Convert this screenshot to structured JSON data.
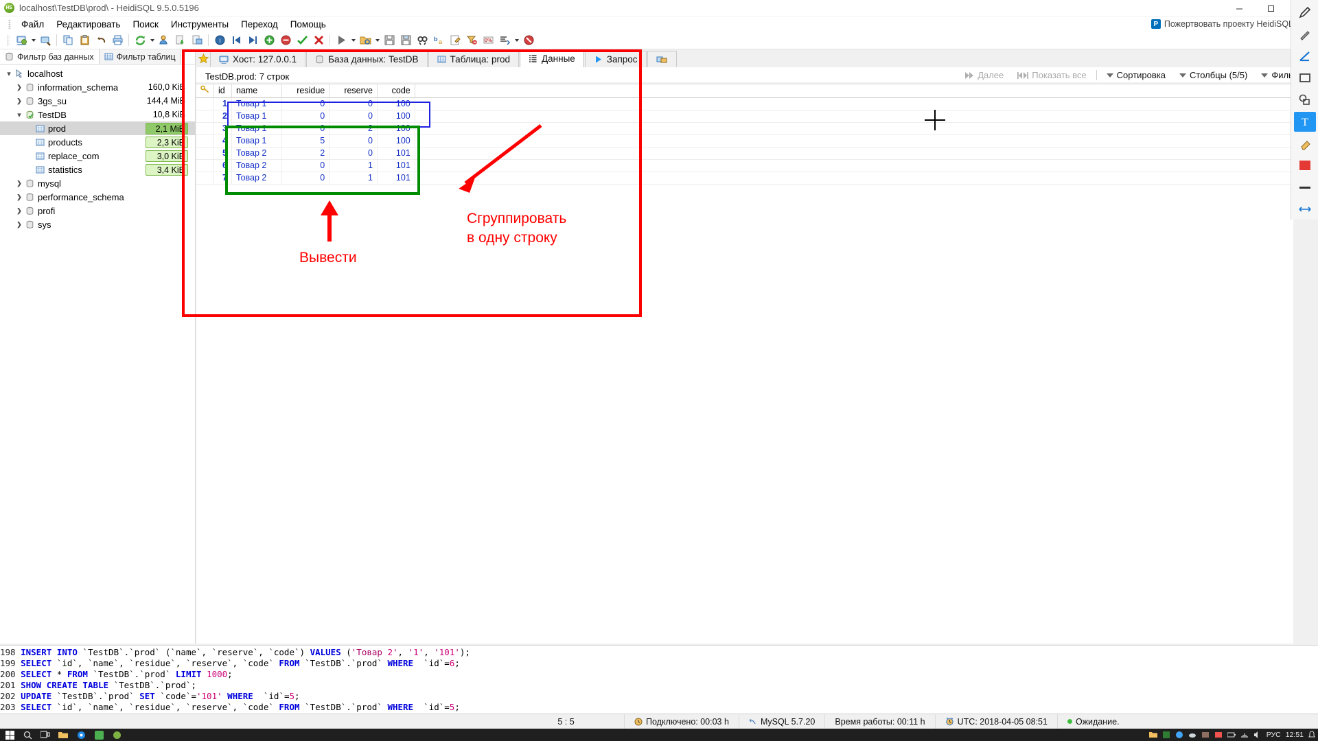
{
  "window": {
    "title": "localhost\\TestDB\\prod\\ - HeidiSQL 9.5.0.5196",
    "logo_text": "HS",
    "minimize_label": "–",
    "maximize_label": "□",
    "close_label": "✕"
  },
  "menu": {
    "items": [
      "Файл",
      "Редактировать",
      "Поиск",
      "Инструменты",
      "Переход",
      "Помощь"
    ]
  },
  "donate": {
    "label": "Пожертвовать проекту HeidiSQL",
    "icon": "paypal-icon",
    "badge": "P"
  },
  "toolbar": {
    "buttons": [
      {
        "name": "session-manager-icon",
        "tip": "Менеджер сессий"
      },
      {
        "name": "new-query-icon",
        "tip": "Новый запрос"
      },
      {
        "name": "copy-icon",
        "tip": "Копировать"
      },
      {
        "name": "paste-icon",
        "tip": "Вставить"
      },
      {
        "name": "undo-icon",
        "tip": "Отменить"
      },
      {
        "name": "print-icon",
        "tip": "Печать"
      },
      {
        "name": "refresh-icon",
        "tip": "Обновить"
      },
      {
        "name": "users-icon",
        "tip": "Менеджер пользователей"
      },
      {
        "name": "export-grid-icon",
        "tip": "Экспорт данных"
      },
      {
        "name": "import-icon",
        "tip": "Импорт"
      },
      {
        "name": "info-icon",
        "tip": "Информация"
      },
      {
        "name": "first-record-icon",
        "tip": "Первая запись"
      },
      {
        "name": "last-record-icon",
        "tip": "Последняя запись"
      },
      {
        "name": "insert-row-icon",
        "tip": "Вставить строку"
      },
      {
        "name": "delete-row-icon",
        "tip": "Удалить строку"
      },
      {
        "name": "apply-icon",
        "tip": "Применить"
      },
      {
        "name": "cancel-icon",
        "tip": "Отменить изменения"
      },
      {
        "name": "run-query-icon",
        "tip": "Выполнить"
      },
      {
        "name": "open-file-icon",
        "tip": "Открыть файл"
      },
      {
        "name": "save-icon",
        "tip": "Сохранить"
      },
      {
        "name": "save-as-icon",
        "tip": "Сохранить как"
      },
      {
        "name": "find-icon",
        "tip": "Найти"
      },
      {
        "name": "replace-icon",
        "tip": "Заменить"
      },
      {
        "name": "edit-icon",
        "tip": "Редактировать"
      },
      {
        "name": "stop-icon",
        "tip": "Остановить"
      }
    ]
  },
  "sidebar": {
    "filter_tabs": [
      {
        "label": "Фильтр баз данных",
        "icon": "database-icon",
        "active": false
      },
      {
        "label": "Фильтр таблиц",
        "icon": "table-icon",
        "active": true
      }
    ],
    "tree": [
      {
        "label": "localhost",
        "size": "",
        "indent": 0,
        "chev": "open",
        "icon": "host-icon",
        "selected": false,
        "chip": false
      },
      {
        "label": "information_schema",
        "size": "160,0 KiB",
        "indent": 1,
        "chev": "closed",
        "icon": "database-icon",
        "selected": false,
        "chip": false
      },
      {
        "label": "3gs_su",
        "size": "144,4 MiB",
        "indent": 1,
        "chev": "closed",
        "icon": "database-icon",
        "selected": false,
        "chip": false
      },
      {
        "label": "TestDB",
        "size": "10,8 KiB",
        "indent": 1,
        "chev": "open",
        "icon": "database-active-icon",
        "selected": false,
        "chip": false
      },
      {
        "label": "prod",
        "size": "2,1 MiB",
        "indent": 2,
        "chev": "none",
        "icon": "table-icon",
        "selected": true,
        "chip": true
      },
      {
        "label": "products",
        "size": "2,3 KiB",
        "indent": 2,
        "chev": "none",
        "icon": "table-icon",
        "selected": false,
        "chip": true
      },
      {
        "label": "replace_com",
        "size": "3,0 KiB",
        "indent": 2,
        "chev": "none",
        "icon": "table-icon",
        "selected": false,
        "chip": true
      },
      {
        "label": "statistics",
        "size": "3,4 KiB",
        "indent": 2,
        "chev": "none",
        "icon": "table-icon",
        "selected": false,
        "chip": true
      },
      {
        "label": "mysql",
        "size": "",
        "indent": 1,
        "chev": "closed",
        "icon": "database-icon",
        "selected": false,
        "chip": false
      },
      {
        "label": "performance_schema",
        "size": "",
        "indent": 1,
        "chev": "closed",
        "icon": "database-icon",
        "selected": false,
        "chip": false
      },
      {
        "label": "profi",
        "size": "",
        "indent": 1,
        "chev": "closed",
        "icon": "database-icon",
        "selected": false,
        "chip": false
      },
      {
        "label": "sys",
        "size": "",
        "indent": 1,
        "chev": "closed",
        "icon": "database-icon",
        "selected": false,
        "chip": false
      }
    ]
  },
  "tabs": [
    {
      "label": "Хост: 127.0.0.1",
      "icon": "host-icon",
      "active": false
    },
    {
      "label": "База данных: TestDB",
      "icon": "database-icon",
      "active": false
    },
    {
      "label": "Таблица: prod",
      "icon": "table-icon",
      "active": false
    },
    {
      "label": "Данные",
      "icon": "data-icon",
      "active": true
    },
    {
      "label": "Запрос",
      "icon": "play-icon",
      "active": false
    },
    {
      "label": "",
      "icon": "new-tab-icon",
      "active": false
    }
  ],
  "grid": {
    "caption": "TestDB.prod: 7 строк",
    "tools": [
      {
        "label": "Далее",
        "icon": "next-icon",
        "disabled": true
      },
      {
        "label": "Показать все",
        "icon": "show-all-icon",
        "disabled": true
      },
      {
        "label": "Сортировка",
        "icon": "caret-down-icon",
        "disabled": false
      },
      {
        "label": "Столбцы (5/5)",
        "icon": "caret-down-icon",
        "disabled": false
      },
      {
        "label": "Фильтр",
        "icon": "caret-down-icon",
        "disabled": false
      }
    ],
    "columns": [
      "id",
      "name",
      "residue",
      "reserve",
      "code"
    ],
    "key_icon": "primary-key-icon",
    "rows": [
      {
        "id": "1",
        "name": "Товар 1",
        "residue": "0",
        "reserve": "0",
        "code": "100"
      },
      {
        "id": "2",
        "name": "Товар 1",
        "residue": "0",
        "reserve": "0",
        "code": "100"
      },
      {
        "id": "3",
        "name": "Товар 1",
        "residue": "0",
        "reserve": "2",
        "code": "100"
      },
      {
        "id": "4",
        "name": "Товар 1",
        "residue": "5",
        "reserve": "0",
        "code": "100"
      },
      {
        "id": "5",
        "name": "Товар 2",
        "residue": "2",
        "reserve": "0",
        "code": "101"
      },
      {
        "id": "6",
        "name": "Товар 2",
        "residue": "0",
        "reserve": "1",
        "code": "101"
      },
      {
        "id": "7",
        "name": "Товар 2",
        "residue": "0",
        "reserve": "1",
        "code": "101"
      }
    ]
  },
  "annotations": {
    "group_text_line1": "Сгруппировать",
    "group_text_line2": "в одну строку",
    "output_text": "Вывести",
    "red_color": "#fb0000",
    "blue_color": "#2020e0",
    "green_color": "#008c00"
  },
  "sql_log": {
    "lines": [
      {
        "num": "198",
        "sql": "INSERT INTO `TestDB`.`prod` (`name`, `reserve`, `code`) VALUES ('Товар 2', '1', '101');"
      },
      {
        "num": "199",
        "sql": "SELECT `id`, `name`, `residue`, `reserve`, `code` FROM `TestDB`.`prod` WHERE  `id`=6;"
      },
      {
        "num": "200",
        "sql": "SELECT * FROM `TestDB`.`prod` LIMIT 1000;"
      },
      {
        "num": "201",
        "sql": "SHOW CREATE TABLE `TestDB`.`prod`;"
      },
      {
        "num": "202",
        "sql": "UPDATE `TestDB`.`prod` SET `code`='101' WHERE  `id`=5;"
      },
      {
        "num": "203",
        "sql": "SELECT `id`, `name`, `residue`, `reserve`, `code` FROM `TestDB`.`prod` WHERE  `id`=5;"
      }
    ]
  },
  "statusbar": {
    "cursor_pos": "5 : 5",
    "connected": "Подключено: 00:03 h",
    "server": "MySQL 5.7.20",
    "uptime": "Время работы: 00:11 h",
    "utc": "UTC: 2018-04-05 08:51",
    "state": "Ожидание."
  },
  "taskbar": {
    "clock": "12:51",
    "lang": "РУС",
    "icons": [
      "start-icon",
      "search-icon",
      "taskview-icon",
      "explorer-icon",
      "browser-icon",
      "app-icon",
      "heidisql-icon"
    ],
    "tray_icons": [
      "folder-icon",
      "paint-icon",
      "chrome-icon",
      "cloud-icon",
      "app2-icon",
      "app3-icon",
      "battery-icon",
      "network-icon",
      "volume-icon"
    ]
  },
  "palette": {
    "tools": [
      {
        "name": "pen-tool",
        "active": false
      },
      {
        "name": "marker-tool",
        "active": false
      },
      {
        "name": "line-tool",
        "active": false
      },
      {
        "name": "rect-tool",
        "active": false
      },
      {
        "name": "shapes-tool",
        "active": false
      },
      {
        "name": "text-tool",
        "active": true
      },
      {
        "name": "eraser-tool",
        "active": false
      },
      {
        "name": "color-red-swatch",
        "active": false
      },
      {
        "name": "thickness-tool",
        "active": false
      },
      {
        "name": "move-tool",
        "active": false
      }
    ]
  }
}
